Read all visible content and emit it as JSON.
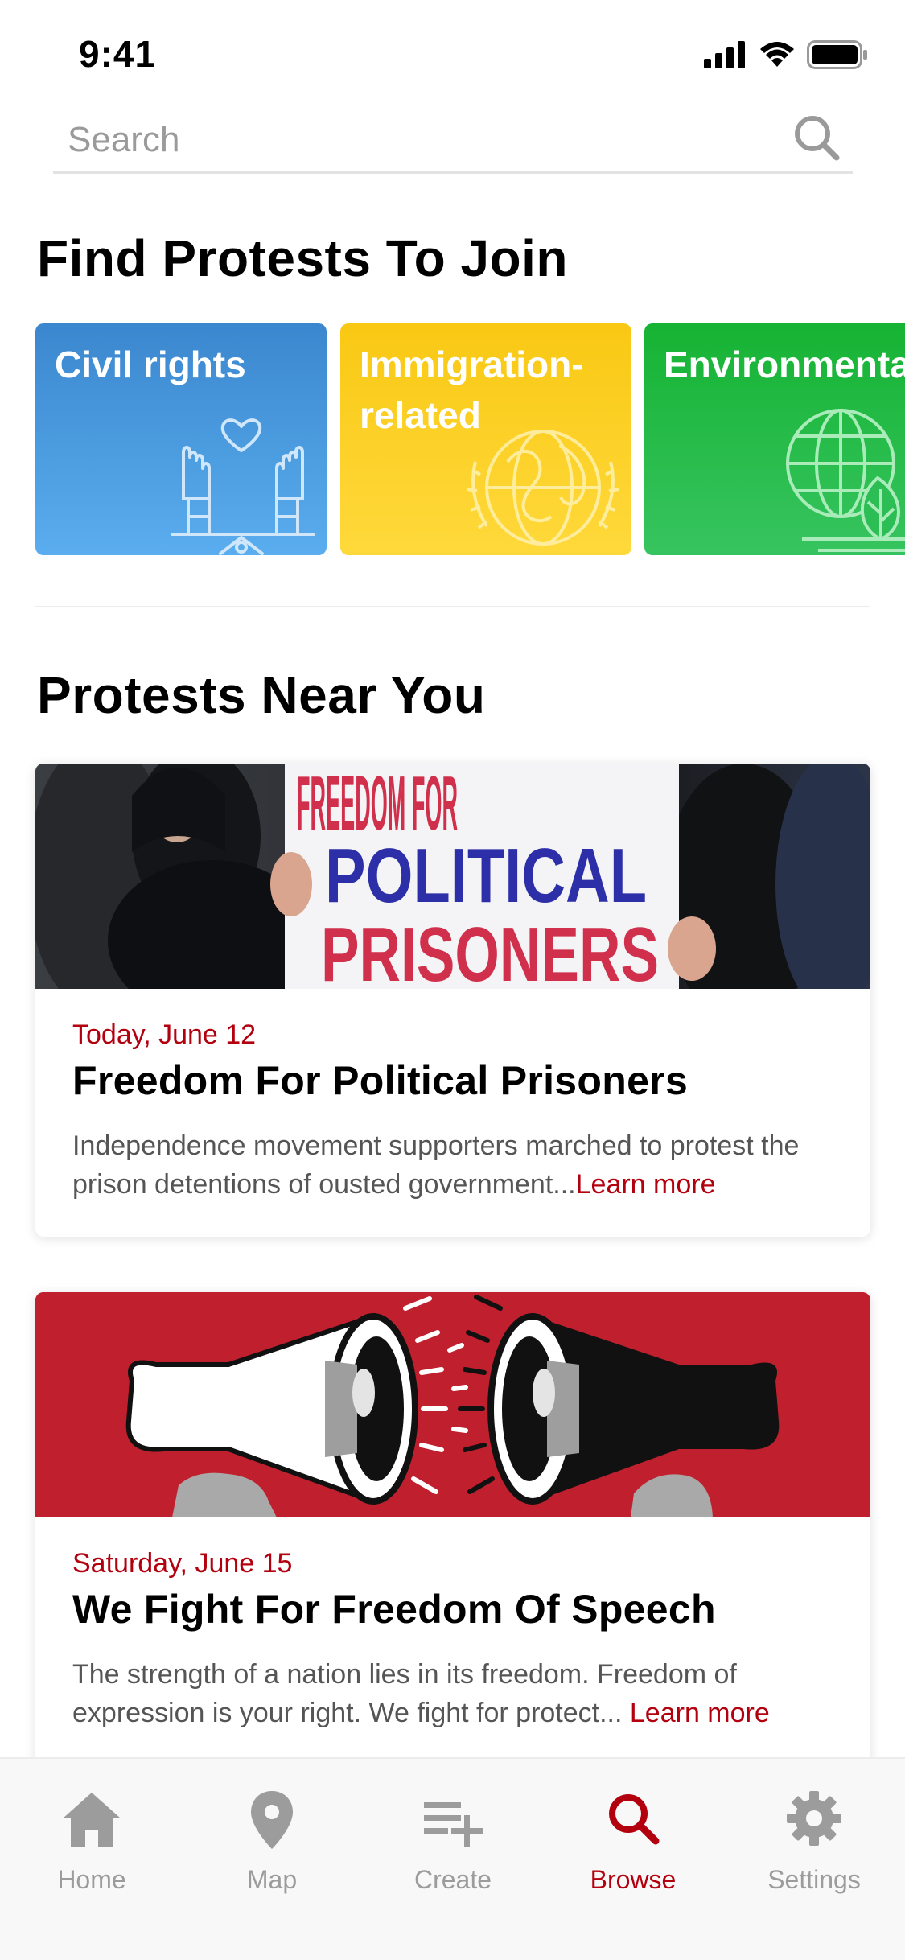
{
  "status_bar": {
    "time": "9:41"
  },
  "search": {
    "placeholder": "Search"
  },
  "categories_section": {
    "title": "Find Protests To Join",
    "items": [
      {
        "label": "Civil rights",
        "icon": "raised-hands-icon",
        "color": "#3b87cf"
      },
      {
        "label": "Immigration-related",
        "label_lines": [
          "Immigration-",
          "related"
        ],
        "icon": "un-globe-emblem-icon",
        "color": "#f9c814"
      },
      {
        "label": "Environmental",
        "icon": "globe-leaf-icon",
        "color": "#16b333"
      }
    ]
  },
  "nearby_section": {
    "title": "Protests Near You",
    "events": [
      {
        "date": "Today, June 12",
        "title": "Freedom For Political Prisoners",
        "description": "Independence movement supporters marched to protest the prison detentions of ousted government...",
        "learn_more": "Learn more",
        "image": "protest-sign-photo",
        "sign_lines": [
          "FREEDOM FOR",
          "POLITICAL",
          "PRISONERS"
        ]
      },
      {
        "date": "Saturday, June 15",
        "title": "We Fight For Freedom Of Speech",
        "description": "The strength of a nation lies in its freedom. Freedom of expression is your right. We fight for protect...",
        "learn_more": "Learn more",
        "image": "megaphones-illustration",
        "image_bg": "#c01f2e"
      }
    ]
  },
  "tab_bar": {
    "items": [
      {
        "label": "Home",
        "icon": "home-icon",
        "active": false
      },
      {
        "label": "Map",
        "icon": "map-pin-icon",
        "active": false
      },
      {
        "label": "Create",
        "icon": "playlist-add-icon",
        "active": false
      },
      {
        "label": "Browse",
        "icon": "search-icon",
        "active": true
      },
      {
        "label": "Settings",
        "icon": "gear-icon",
        "active": false
      }
    ],
    "active_color": "#b3000f",
    "inactive_color": "#9c9c9c"
  }
}
